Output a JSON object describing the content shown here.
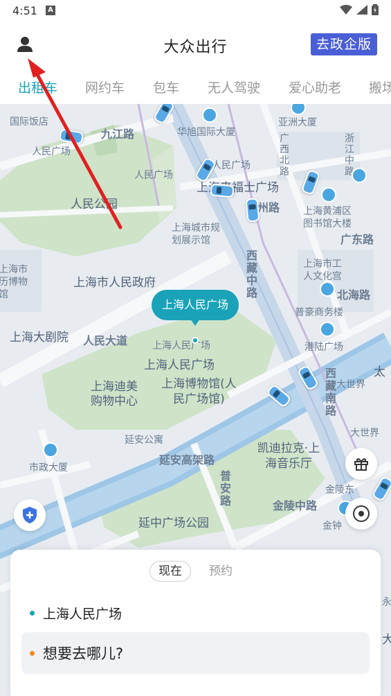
{
  "status_bar": {
    "time": "4:51",
    "notification_letter": "A"
  },
  "header": {
    "title": "大众出行",
    "gov_button": "去政企版",
    "profile_icon": "person-icon"
  },
  "tabs": [
    {
      "label": "出租车",
      "active": true
    },
    {
      "label": "网约车",
      "active": false
    },
    {
      "label": "包车",
      "active": false
    },
    {
      "label": "无人驾驶",
      "active": false
    },
    {
      "label": "爱心助老",
      "active": false
    },
    {
      "label": "搬场",
      "active": false
    }
  ],
  "map": {
    "pin_label": "上海人民广场",
    "labels": [
      "国际饭店",
      "九江路",
      "华旭国际大厦",
      "亚洲大厦",
      "浙江中路",
      "人民广场",
      "广西北路",
      "人民广场",
      "人民广场",
      "上海来福士广场",
      "人民公园",
      "福州路",
      "上海黄浦区图书馆大楼",
      "上海城市规划展示馆",
      "广东路",
      "西藏中路",
      "上海市历博物馆",
      "上海市人民政府",
      "上海市工人文化宫",
      "北海路",
      "普豪商务楼",
      "上海大剧院",
      "人民大道",
      "上海人民广场",
      "上海人民广场",
      "港陆广场",
      "上海迪美购物中心",
      "上海博物馆(人民广场馆)",
      "西藏南路",
      "大世界",
      "太",
      "延安公寓",
      "凯迪拉克·上海音乐厅",
      "市政大厦",
      "延安高架路",
      "普安路",
      "大世界",
      "金陵中路",
      "金陵东",
      "延中广场公园",
      "金钟",
      "永",
      "大"
    ]
  },
  "booking": {
    "time_now": "现在",
    "time_later": "预约",
    "origin": "上海人民广场",
    "destination_placeholder": "想要去哪儿?",
    "origin_color": "#1aa3b8",
    "dest_color": "#f08a24"
  },
  "colors": {
    "accent": "#1aa3b8",
    "gov_button": "#4a5fd6",
    "arrow": "#e02020"
  }
}
